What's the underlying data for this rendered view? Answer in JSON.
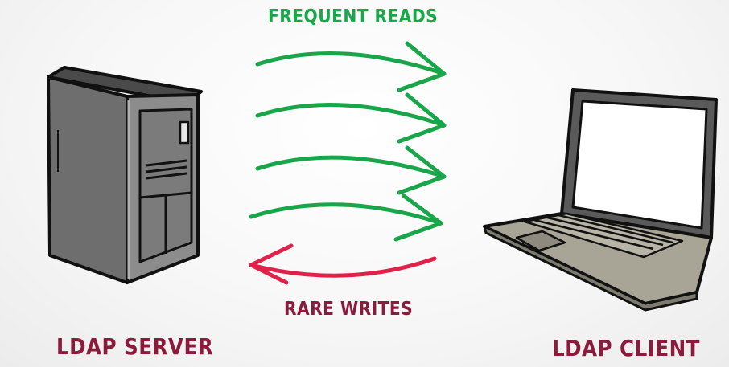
{
  "labels": {
    "reads": "FREQUENT READS",
    "writes": "RARE WRITES",
    "server": "LDAP SERVER",
    "client": "LDAP CLIENT"
  },
  "colors": {
    "reads_arrow": "#19a64a",
    "writes_arrow": "#e0224a",
    "label_dark": "#8a1b3b",
    "reads_label": "#17a84a"
  },
  "icons": {
    "server": "server-tower-icon",
    "client": "laptop-icon"
  }
}
